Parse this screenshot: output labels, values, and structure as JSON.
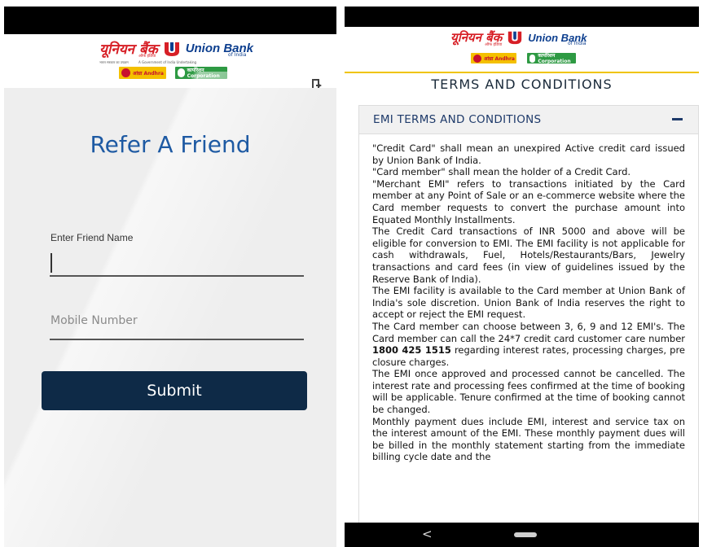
{
  "left_screen": {
    "logo": {
      "hindi": "यूनियन बैंक",
      "hindi_sub": "ऑफ इंडिया",
      "english": "Union Bank",
      "english_sub": "of India",
      "tag_hindi": "भारत सरकार का उपक्रम",
      "tag_english": "A Government of India Undertaking",
      "partner_1": "आंध्रा Andhra",
      "partner_2": "कार्पोरेशन Corporation"
    },
    "page_title": "Refer A Friend",
    "name_label": "Enter Friend Name",
    "name_value": "",
    "mobile_placeholder": "Mobile Number",
    "submit_label": "Submit"
  },
  "right_screen": {
    "logo": {
      "hindi": "यूनियन बैंक",
      "hindi_sub": "ऑफ इंडिया",
      "english": "Union Bank",
      "english_sub": "of India",
      "partner_1": "आंध्रा Andhra",
      "partner_2": "कार्पोरेशन Corporation"
    },
    "title": "TERMS AND CONDITIONS",
    "section_header": "EMI TERMS AND CONDITIONS",
    "paragraphs": [
      "\"Credit Card\" shall mean an unexpired Active credit card issued by Union Bank of India.",
      "\"Card member\" shall mean the holder of a Credit Card.",
      "\"Merchant EMI\" refers to transactions initiated by the Card member at any Point of Sale or an e-commerce website where the Card member requests to convert the purchase amount into Equated Monthly Installments.",
      "The Credit Card transactions of INR 5000 and above will be eligible for conversion to EMI. The EMI facility is not applicable for cash withdrawals, Fuel, Hotels/Restaurants/Bars, Jewelry transactions and card fees (in view of guidelines issued by the Reserve Bank of India).",
      "The EMI facility is available to the Card member at Union Bank of India's sole discretion. Union Bank of India reserves the right to accept or reject the EMI request."
    ],
    "para_emi_a": "The Card member can choose between 3, 6, 9 and 12 EMI's. The Card member can call the 24*7 credit card customer care number ",
    "phone_number": "1800 425 1515",
    "para_emi_b": " regarding interest rates, processing charges, pre closure charges.",
    "paragraphs_2": [
      "The EMI once approved and processed cannot be cancelled. The interest rate and processing fees confirmed at the time of booking will be applicable. Tenure confirmed at the time of booking cannot be changed.",
      "Monthly payment dues include EMI, interest and service tax on the interest amount of the EMI. These monthly payment dues will be billed in the monthly statement starting from the immediate billing cycle date and the"
    ],
    "nav_back_glyph": "<"
  },
  "colors": {
    "brand_red": "#d71f26",
    "brand_blue": "#0d3f8f",
    "title_blue": "#1e5aa3",
    "submit_bg": "#0e2a47",
    "accent_yellow": "#f0c400"
  }
}
